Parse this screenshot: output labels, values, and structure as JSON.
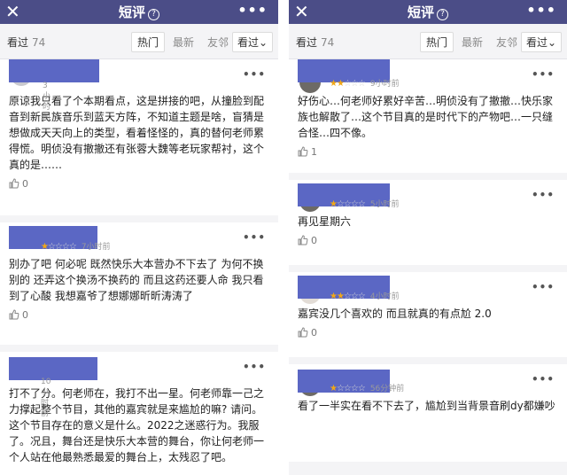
{
  "left": {
    "topbar": {
      "close": "✕",
      "title": "短评",
      "help": "?",
      "more": "•••"
    },
    "filter": {
      "label": "看过",
      "count": "74",
      "tabs": [
        "热门",
        "最新",
        "友邻"
      ],
      "sort": "看过⌄"
    },
    "reviews": [
      {
        "stars": 0,
        "time": "3小时前",
        "text": "原谅我只看了个本期看点，这是拼接的吧，从撞脸到配音到新民族音乐到蓝天方阵，不知道主题是啥，盲猜是想做成天天向上的类型，看着怪怪的，真的替何老师累得慌。明侦没有撤撤还有张蓉大魏等老玩家帮衬，这个真的是……",
        "likes": "0"
      },
      {
        "stars": 1,
        "time": "7小时前",
        "text": " 别办了吧 何必呢 既然快乐大本营办不下去了 为何不换别的 还弄这个换汤不换药的 而且这药还要人命 我只看到了心酸 我想嘉爷了想娜娜昕昕涛涛了",
        "likes": "0"
      },
      {
        "stars": 0,
        "time": "10小时前",
        "text": "打不了分。何老师在，我打不出一星。何老师靠一己之力撑起整个节目，其他的嘉宾就是来尴尬的嘛? 请问。这个节目存在的意义是什么。2022之迷惑行为。我服了。况且，舞台还是快乐大本营的舞台，你让何老师一个人站在他最熟悉最爱的舞台上，太残忍了吧。",
        "likes": ""
      }
    ]
  },
  "right": {
    "topbar": {
      "close": "✕",
      "title": "短评",
      "help": "?",
      "more": "•••"
    },
    "filter": {
      "label": "看过",
      "count": "74",
      "tabs": [
        "热门",
        "最新",
        "友邻"
      ],
      "sort": "看过⌄"
    },
    "reviews": [
      {
        "stars": 2,
        "time": "9小时前",
        "text": "好伤心…何老师好累好辛苦…明侦没有了撤撤…快乐家族也解散了…这个节目真的是时代下的产物吧…一只缝合怪…四不像。",
        "likes": "1"
      },
      {
        "stars": 1,
        "time": "5小时前",
        "text": "再见星期六",
        "likes": "0"
      },
      {
        "stars": 2,
        "time": "4小时前",
        "text": "嘉宾没几个喜欢的 而且就真的有点尬 2.0",
        "likes": "0"
      },
      {
        "stars": 1,
        "time": "56分钟前",
        "text": "看了一半实在看不下去了，尴尬到当背景音刷dy都嫌吵",
        "likes": ""
      }
    ]
  },
  "colors": {
    "topbar": "#4b4d87",
    "star_on": "#f2a817",
    "mask": "#5b67c4"
  }
}
